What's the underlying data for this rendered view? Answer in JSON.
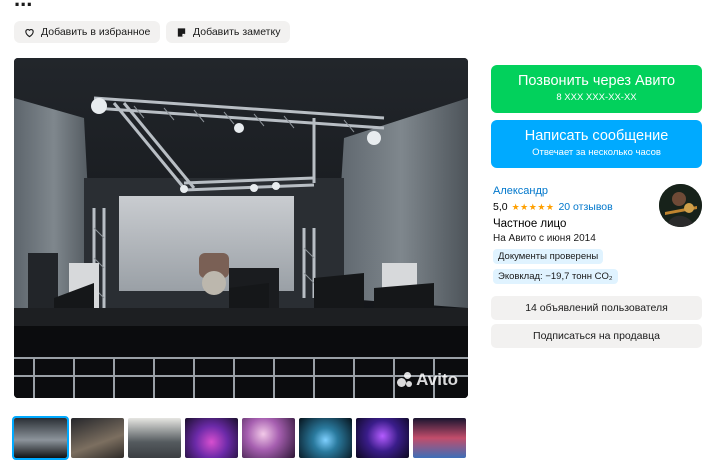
{
  "page": {
    "title_partial": "..."
  },
  "actions": {
    "favorite_label": "Добавить в избранное",
    "note_label": "Добавить заметку"
  },
  "gallery": {
    "watermark": "Avito",
    "thumbnail_count": 8,
    "active_thumbnail_index": 0
  },
  "contact": {
    "call_label": "Позвонить через Авито",
    "call_phone": "8 XXX XXX-XX-XX",
    "message_label": "Написать сообщение",
    "message_sub": "Отвечает за несколько часов"
  },
  "seller": {
    "name": "Александр",
    "rating": "5,0",
    "stars": "★★★★★",
    "reviews": "20 отзывов",
    "type": "Частное лицо",
    "since": "На Авито с июня 2014",
    "badges": [
      "Документы проверены",
      "Эковклад: −19,7 тонн CO₂"
    ]
  },
  "seller_actions": {
    "listings_label": "14 объявлений пользователя",
    "subscribe_label": "Подписаться на продавца"
  },
  "colors": {
    "call_green": "#02d15c",
    "message_blue": "#00aaff",
    "link_blue": "#0077cc",
    "star_orange": "#ffa000",
    "badge_bg": "#e0f3ff"
  }
}
